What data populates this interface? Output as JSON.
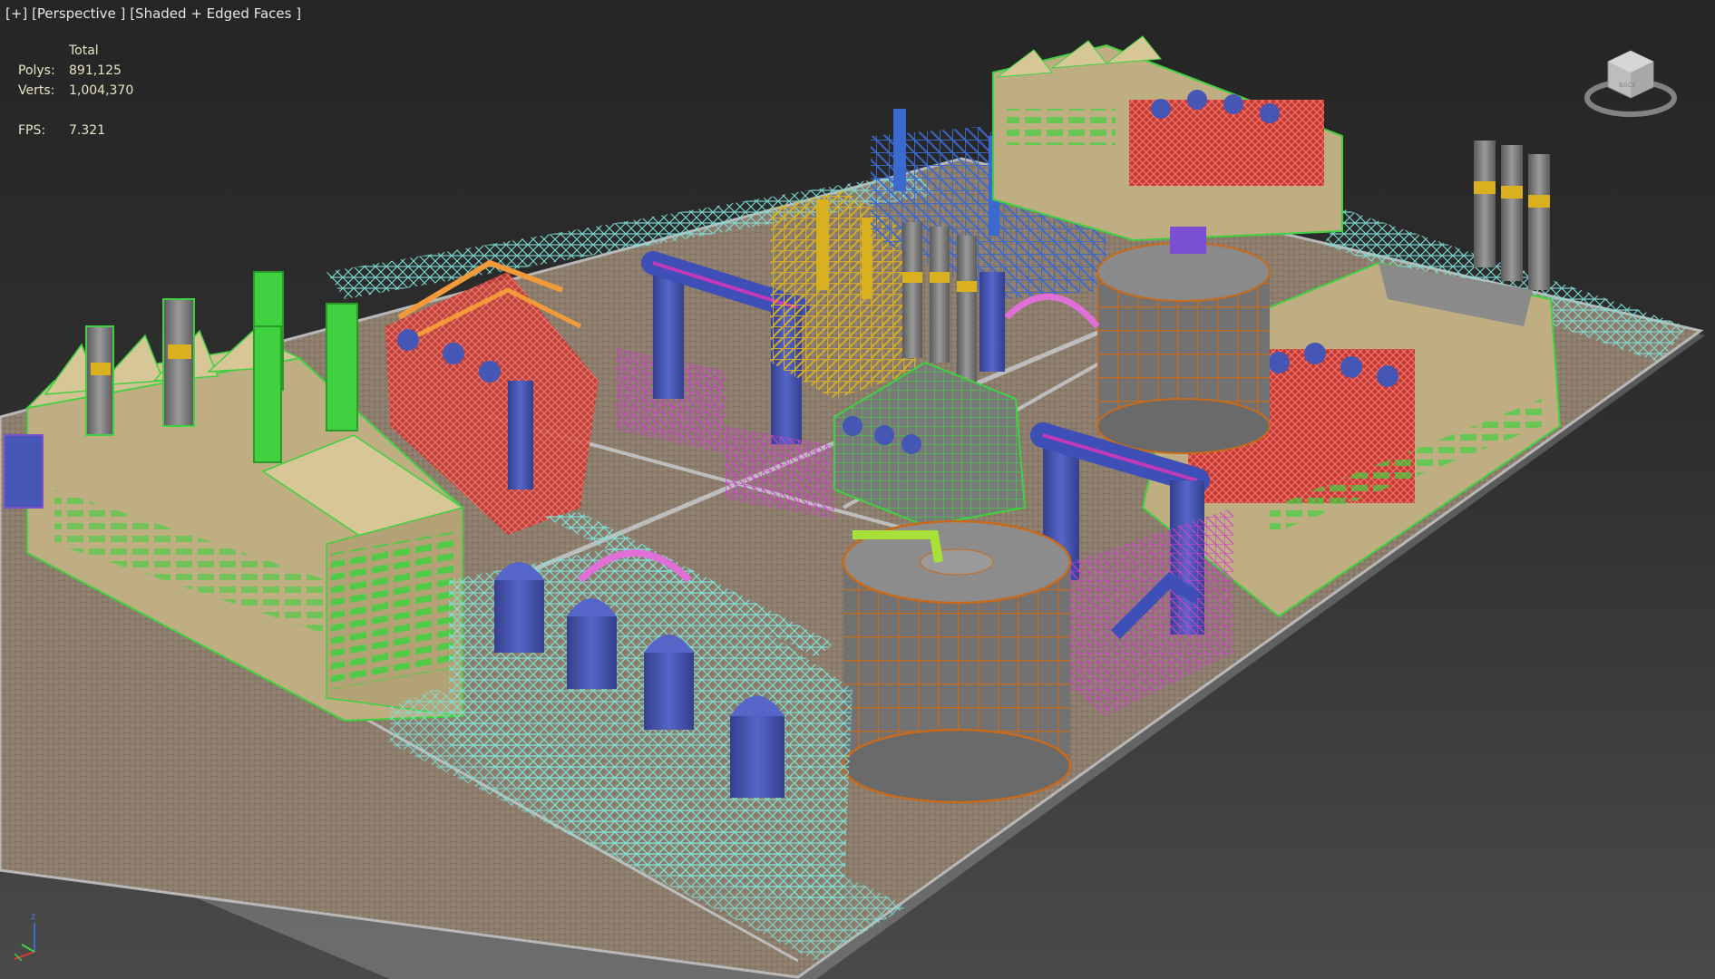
{
  "viewport": {
    "menu_plus": "[+]",
    "view_name": "[Perspective ]",
    "shading_mode": "[Shaded + Edged Faces ]"
  },
  "stats": {
    "header": "Total",
    "polys_label": "Polys:",
    "polys_value": "891,125",
    "verts_label": "Verts:",
    "verts_value": "1,004,370",
    "fps_label": "FPS:",
    "fps_value": "7.321"
  },
  "viewcube": {
    "face_label": "BACK"
  },
  "axis": {
    "z_label": "z"
  },
  "colors": {
    "background": "#2b2b2b",
    "ground": "#8c7c6c",
    "building": "#c9b88c",
    "wire_cyan": "#7fe0d6",
    "wire_green": "#3fd13f",
    "wire_red": "#e8504a",
    "wire_magenta": "#d03fd0",
    "wire_orange": "#d07020",
    "wire_blue": "#3a6ad0",
    "wire_yellow": "#d8b020",
    "tank_blue": "#4656b4",
    "hud_text": "#e8e4c8"
  }
}
